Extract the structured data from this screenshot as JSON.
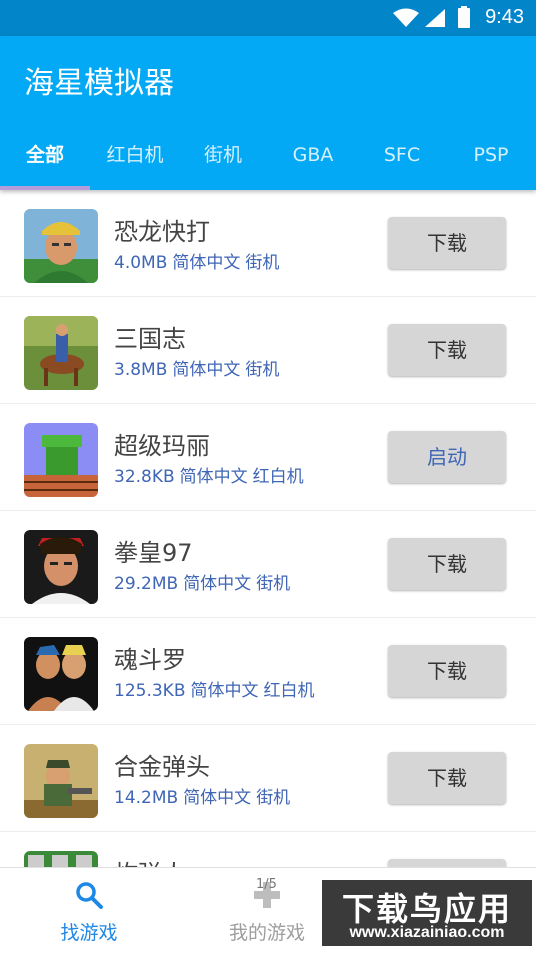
{
  "status": {
    "time": "9:43"
  },
  "app": {
    "title": "海星模拟器"
  },
  "tabs": [
    {
      "label": "全部"
    },
    {
      "label": "红白机"
    },
    {
      "label": "街机"
    },
    {
      "label": "GBA"
    },
    {
      "label": "SFC"
    },
    {
      "label": "PSP"
    }
  ],
  "games": [
    {
      "name": "恐龙快打",
      "size": "4.0MB",
      "lang": "简体中文",
      "platform": "街机",
      "action": "下载"
    },
    {
      "name": "三国志",
      "size": "3.8MB",
      "lang": "简体中文",
      "platform": "街机",
      "action": "下载"
    },
    {
      "name": "超级玛丽",
      "size": "32.8KB",
      "lang": "简体中文",
      "platform": "红白机",
      "action": "启动"
    },
    {
      "name": "拳皇97",
      "size": "29.2MB",
      "lang": "简体中文",
      "platform": "街机",
      "action": "下载"
    },
    {
      "name": "魂斗罗",
      "size": "125.3KB",
      "lang": "简体中文",
      "platform": "红白机",
      "action": "下载"
    },
    {
      "name": "合金弹头",
      "size": "14.2MB",
      "lang": "简体中文",
      "platform": "街机",
      "action": "下载"
    },
    {
      "name": "炸弹人",
      "size": "",
      "lang": "",
      "platform": "",
      "action": ""
    }
  ],
  "bottom_nav": [
    {
      "label": "找游戏",
      "icon": "search-icon"
    },
    {
      "label": "我的游戏",
      "icon": "gamepad-icon"
    }
  ],
  "badge": "1/5",
  "watermark": {
    "big": "下载鸟应用",
    "small": "www.xiazainiao.com"
  },
  "colors": {
    "primary": "#03a9f4",
    "status_bar": "#0385c9",
    "meta_text": "#3f65b5",
    "indicator": "#b39ddb"
  }
}
